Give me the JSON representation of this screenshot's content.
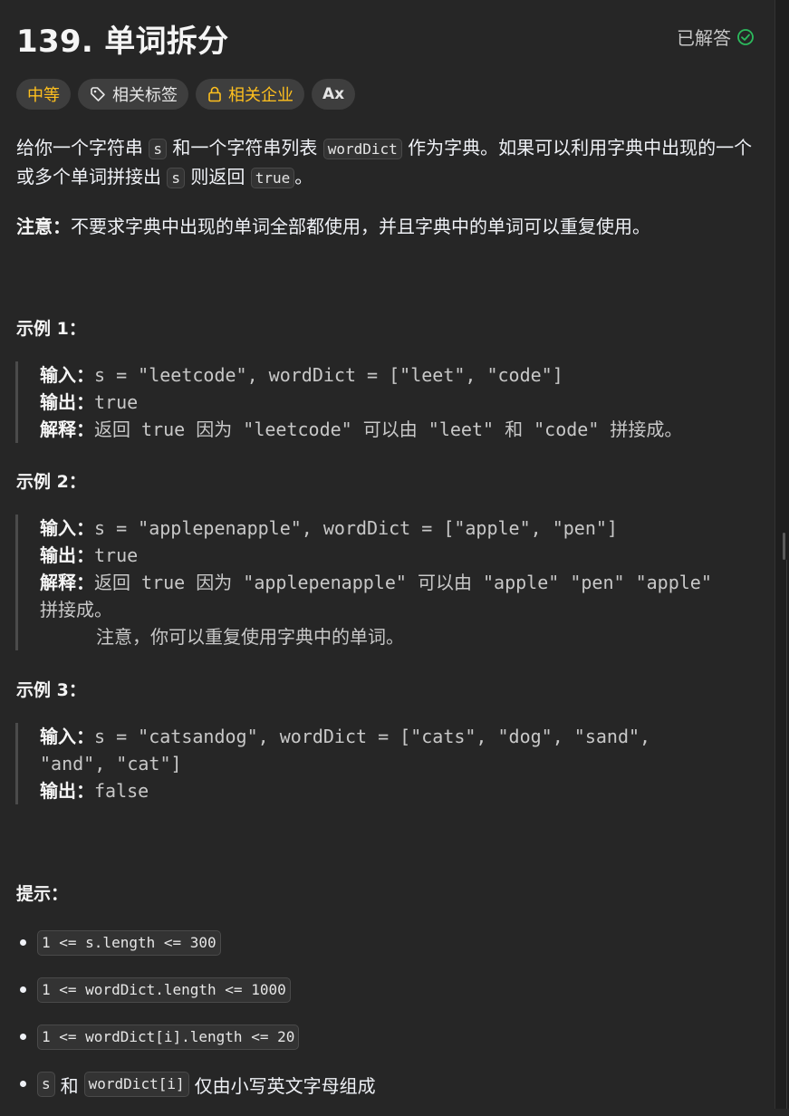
{
  "header": {
    "title": "139. 单词拆分",
    "status": "已解答"
  },
  "tags": {
    "difficulty": "中等",
    "topics": "相关标签",
    "companies": "相关企业",
    "font_toggle": "Ax"
  },
  "description": {
    "p1": {
      "t1": "给你一个字符串 ",
      "c1": "s",
      "t2": " 和一个字符串列表 ",
      "c2": "wordDict",
      "t3": " 作为字典。如果可以利用字典中出现的一个或多个单词拼接出 ",
      "c3": "s",
      "t4": " 则返回 ",
      "c4": "true",
      "t5": "。"
    },
    "note_label": "注意：",
    "note_text": "不要求字典中出现的单词全部都使用，并且字典中的单词可以重复使用。"
  },
  "examples": [
    {
      "title": "示例 1：",
      "input_label": "输入：",
      "input": "s = \"leetcode\", wordDict = [\"leet\", \"code\"]",
      "output_label": "输出：",
      "output": "true",
      "explain_label": "解释：",
      "explain_parts": [
        "返回",
        " true ",
        "因为",
        " \"leetcode\" ",
        "可以由",
        " \"leet\" ",
        "和",
        " \"code\" ",
        "拼接成。"
      ]
    },
    {
      "title": "示例 2：",
      "input_label": "输入：",
      "input": "s = \"applepenapple\", wordDict = [\"apple\", \"pen\"]",
      "output_label": "输出：",
      "output": "true",
      "explain_label": "解释：",
      "explain_parts": [
        "返回",
        " true ",
        "因为",
        " \"applepenapple\" ",
        "可以由",
        " \"apple\" \"pen\" \"apple\""
      ],
      "explain_wrap": "拼接成。",
      "explain_note": "注意，你可以重复使用字典中的单词。"
    },
    {
      "title": "示例 3：",
      "input_label": "输入：",
      "input_line1": "s = \"catsandog\", wordDict = [\"cats\", \"dog\", \"sand\",",
      "input_line2": "\"and\", \"cat\"]",
      "output_label": "输出：",
      "output": "false"
    }
  ],
  "hints": {
    "title": "提示：",
    "items": [
      "1 <= s.length <= 300",
      "1 <= wordDict.length <= 1000",
      "1 <= wordDict[i].length <= 20"
    ],
    "last": {
      "c1": "s",
      "t1": "和",
      "c2": "wordDict[i]",
      "t2": "仅由小写英文字母组成"
    }
  },
  "colors": {
    "background": "#262626",
    "difficulty_medium": "#ffc01e",
    "solved_green": "#2cbb5d"
  }
}
